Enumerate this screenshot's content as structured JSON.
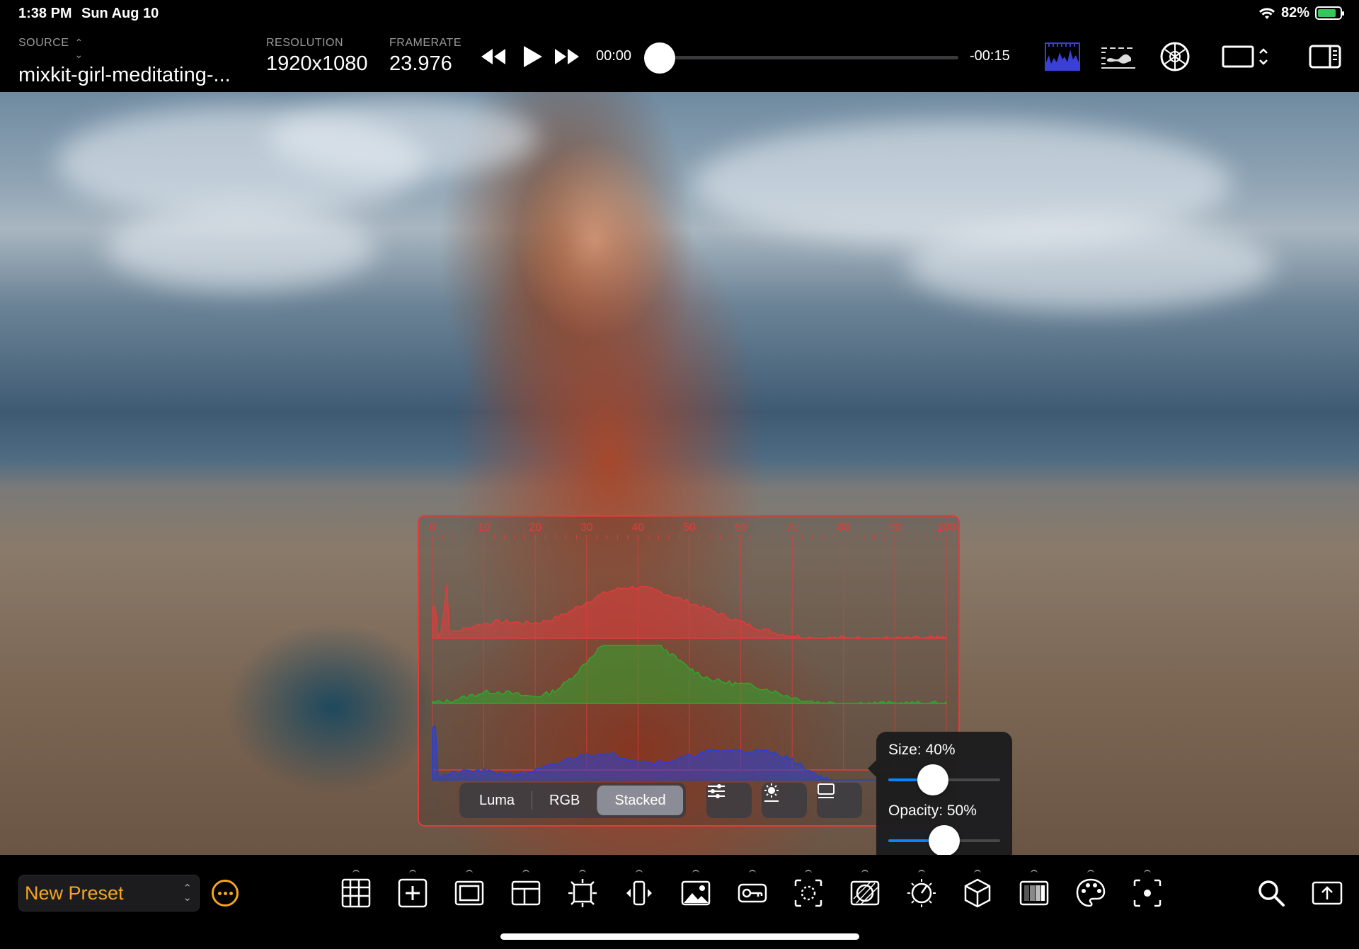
{
  "status": {
    "time": "1:38 PM",
    "date": "Sun Aug 10",
    "battery": "82%"
  },
  "header": {
    "source_label": "SOURCE",
    "source_value": "mixkit-girl-meditating-...",
    "resolution_label": "RESOLUTION",
    "resolution_value": "1920x1080",
    "framerate_label": "FRAMERATE",
    "framerate_value": "23.976",
    "time_current": "00:00",
    "time_remaining": "-00:15",
    "scrub_progress": 0
  },
  "histogram": {
    "scale": [
      "0",
      "10",
      "20",
      "30",
      "40",
      "50",
      "60",
      "70",
      "80",
      "90",
      "100"
    ],
    "modes": [
      "Luma",
      "RGB",
      "Stacked"
    ],
    "active_mode": "Stacked",
    "channels": [
      "red",
      "green",
      "blue"
    ],
    "colors": {
      "red": "#e03c3c",
      "green": "#2ea82e",
      "blue": "#2a3fd8",
      "frame": "#e03c3c"
    }
  },
  "popover": {
    "size_label": "Size: 40%",
    "size_value": 0.4,
    "opacity_label": "Opacity: 50%",
    "opacity_value": 0.5
  },
  "footer": {
    "preset_name": "New Preset",
    "tools": [
      "grid-icon",
      "add-box-icon",
      "frame-icon",
      "layout-icon",
      "crop-icon",
      "flip-icon",
      "image-icon",
      "key-icon",
      "focus-icon",
      "zebra-icon",
      "exposure-icon",
      "cube-icon",
      "gradient-icon",
      "palette-icon",
      "record-icon"
    ]
  },
  "colors": {
    "accent": "#f5a623",
    "slider": "#0a84ff",
    "histogram_active_icon": "#3a3fd8"
  }
}
